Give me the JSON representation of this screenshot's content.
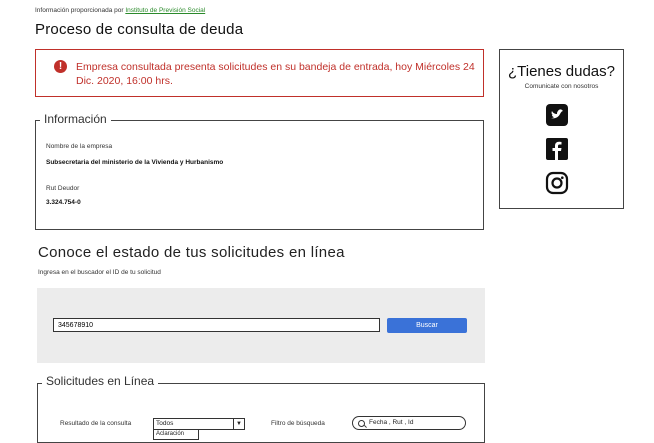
{
  "credit": {
    "prefix": "Información proporcionada por",
    "link": "Instituto de Previsión Social"
  },
  "page_title": "Proceso de consulta de deuda",
  "alert": {
    "icon": "exclamation-icon",
    "text": "Empresa consultada presenta solicitudes en su bandeja de entrada, hoy Miércoles 24 Dic. 2020, 16:00 hrs.",
    "color": "#c0302a"
  },
  "info": {
    "legend": "Información",
    "company_label": "Nombre de la empresa",
    "company_value": "Subsecretaria del ministerio de la Vivienda y Hurbanismo",
    "rut_label": "Rut Deudor",
    "rut_value": "3.324.754-0"
  },
  "help": {
    "title": "¿Tienes dudas?",
    "subtitle": "Comunicate con nosotros",
    "icons": [
      "twitter-icon",
      "facebook-icon",
      "instagram-icon"
    ]
  },
  "status": {
    "title": "Conoce el estado de tus solicitudes en línea",
    "subtitle": "Ingresa en el buscador el ID de tu solicitud",
    "search_value": "345678910",
    "search_button": "Buscar",
    "accent": "#3a72d8"
  },
  "requests": {
    "legend": "Solicitudes en Línea",
    "result_label": "Resultado de la consulta",
    "result_selected": "Todos",
    "result_option_partial": "Aclaración",
    "filter_label": "Filtro de búsqueda",
    "filter_placeholder": "Fecha , Rut , Id"
  }
}
